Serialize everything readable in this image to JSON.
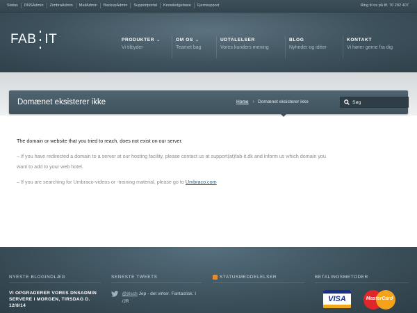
{
  "topbar": {
    "links": [
      "Status",
      "DNSAdmin",
      "ZimbraAdmin",
      "MailAdmin",
      "BackupAdmin",
      "Supportportal",
      "Knowledgebase",
      "Fjernsupport"
    ],
    "phone": "Ring til os på tlf. 70 202 407"
  },
  "header": {
    "logo_left": "FAB",
    "logo_right": "IT",
    "nav": [
      {
        "title": "PRODUKTER",
        "sub": "Vi tilbyder"
      },
      {
        "title": "OM OS",
        "sub": "Teamet bag"
      },
      {
        "title": "UDTALELSER",
        "sub": "Vores kunders mening"
      },
      {
        "title": "BLOG",
        "sub": "Nyheder og idéer"
      },
      {
        "title": "KONTAKT",
        "sub": "Vi hører gerne fra dig"
      }
    ]
  },
  "titlebar": {
    "heading": "Domænet eksisterer ikke",
    "breadcrumb_home": "Home",
    "breadcrumb_current": "Domænet eksisterer ikke",
    "search_placeholder": "Søg"
  },
  "content": {
    "lead": "The domain or website that you tried to reach, does not exist on our server.",
    "para2_line1": "– If you have redirected a domain to a server at our hosting facility, please contact us at support(at)fab-it.dk and inform us which domain you",
    "para2_line2": "want to add to your web hotel.",
    "para3_text": "– If you are searching for Umbraco-videos or -training material, please go to ",
    "para3_link": "Umbraco.com"
  },
  "footer": {
    "blog_heading": "NYESTE BLOGINDLÆG",
    "blog_post": "VI OPGRADERER VORES DNSADMIN SERVERE I MORGEN, TIRSDAG D. 12/8/14",
    "tweets_heading": "SENESTE TWEETS",
    "tweet_user": "@jrisch",
    "tweet_text": " Jep - det virker. Fantastisk. I /JR",
    "status_heading": "STATUSMEDDELELSER",
    "payment_heading": "BETALINGSMETODER",
    "visa_label": "VISA",
    "mastercard_label": "MasterCard"
  }
}
